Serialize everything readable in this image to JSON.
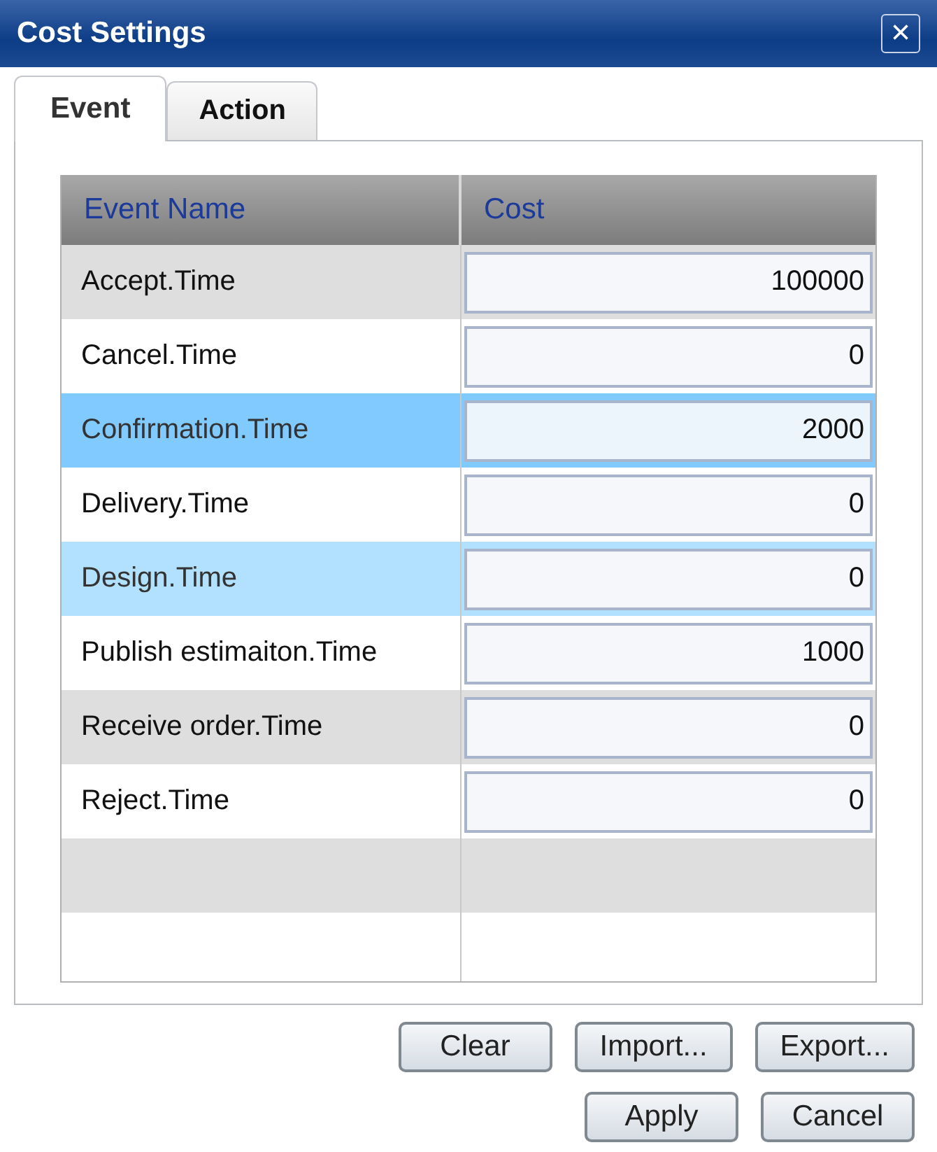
{
  "window": {
    "title": "Cost Settings",
    "close": "×"
  },
  "tabs": [
    {
      "label": "Event",
      "selected": true
    },
    {
      "label": "Action",
      "selected": false
    }
  ],
  "table": {
    "columns": [
      "Event Name",
      "Cost"
    ],
    "rows": [
      {
        "name": "Accept.Time",
        "cost": "100000",
        "selected": false,
        "hovered": false
      },
      {
        "name": "Cancel.Time",
        "cost": "0",
        "selected": false,
        "hovered": false
      },
      {
        "name": "Confirmation.Time",
        "cost": "2000",
        "selected": true,
        "hovered": false
      },
      {
        "name": "Delivery.Time",
        "cost": "0",
        "selected": false,
        "hovered": false
      },
      {
        "name": "Design.Time",
        "cost": "0",
        "selected": false,
        "hovered": true
      },
      {
        "name": "Publish estimaiton.Time",
        "cost": "1000",
        "selected": false,
        "hovered": false
      },
      {
        "name": "Receive order.Time",
        "cost": "0",
        "selected": false,
        "hovered": false
      },
      {
        "name": "Reject.Time",
        "cost": "0",
        "selected": false,
        "hovered": false
      }
    ]
  },
  "buttons": [
    [
      "Clear",
      "Import...",
      "Export..."
    ],
    [
      "Apply",
      "Cancel"
    ]
  ]
}
